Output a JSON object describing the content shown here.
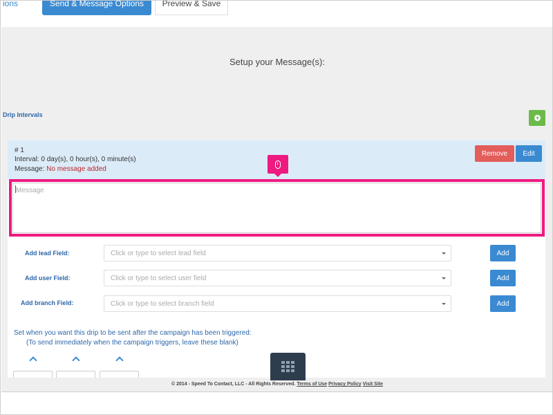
{
  "tabs": {
    "prev_label": "ions",
    "active_label": "Send & Message Options",
    "next_label": "Preview & Save"
  },
  "page": {
    "setup_title": "Setup your Message(s):",
    "drip_intervals_label": "Drip Intervals"
  },
  "interval": {
    "number": "# 1",
    "interval_text": "Interval: 0 day(s), 0 hour(s), 0 minute(s)",
    "message_prefix": "Message:",
    "message_status": "No message added",
    "remove_label": "Remove",
    "edit_label": "Edit"
  },
  "message_field": {
    "placeholder": "Message"
  },
  "fields": [
    {
      "label": "Add lead Field:",
      "placeholder": "Click or type to select lead field",
      "button": "Add"
    },
    {
      "label": "Add user Field:",
      "placeholder": "Click or type to select user field",
      "button": "Add"
    },
    {
      "label": "Add branch Field:",
      "placeholder": "Click or type to select branch field",
      "button": "Add"
    }
  ],
  "timing": {
    "note_line1": "Set when you want this drip to be sent after the campaign has been triggered:",
    "note_line2": "(To send immediately when the campaign triggers, leave these blank)"
  },
  "footer": {
    "copyright": "© 2014 - Speed To Contact, LLC - All Rights Reserved.",
    "terms_label": "Terms of Use",
    "privacy_label": "Privacy Policy",
    "visit_label": "Visit Site"
  },
  "colors": {
    "primary": "#3a8ad2",
    "danger": "#e35d5b",
    "success": "#6cbb4a",
    "highlight": "#ee1a80"
  },
  "icons": {
    "add_interval": "plus-circle-icon",
    "badge": "mouse-icon",
    "dropdown": "chevron-down-icon",
    "spinner": "chevron-up-icon",
    "grid": "grid-icon"
  }
}
